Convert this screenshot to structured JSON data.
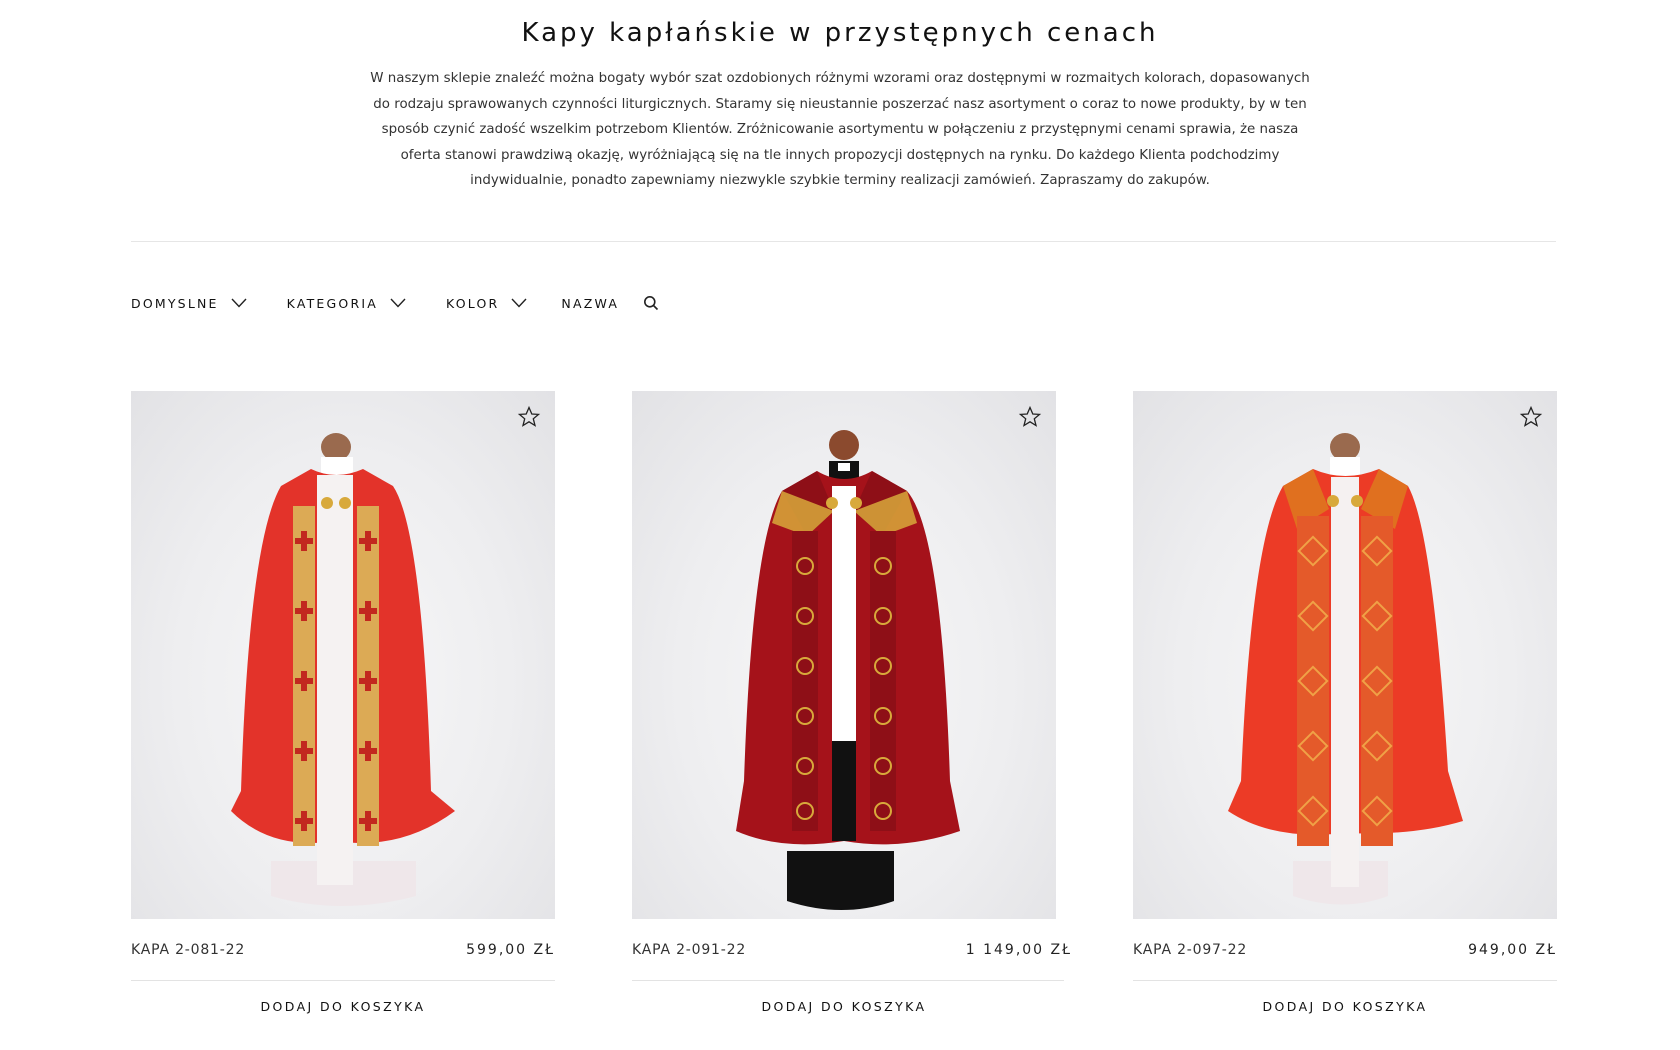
{
  "page": {
    "heading": "Kapy kapłańskie w przystępnych cenach",
    "intro": "W naszym sklepie znaleźć można bogaty wybór szat ozdobionych różnymi wzorami oraz dostępnymi w rozmaitych kolorach, dopasowanych do rodzaju sprawowanych czynności liturgicznych. Staramy się nieustannie poszerzać nasz asortyment o coraz to nowe produkty, by w ten sposób czynić zadość wszelkim potrzebom Klientów. Zróżnicowanie asortymentu w połączeniu z przystępnymi cenami sprawia, że nasza oferta stanowi prawdziwą okazję, wyróżniającą się na tle innych propozycji dostępnych na rynku. Do każdego Klienta podchodzimy indywidualnie, ponadto zapewniamy niezwykle szybkie terminy realizacji zamówień. Zapraszamy do zakupów."
  },
  "filters": {
    "sort_label": "DOMYSLNE",
    "category_label": "KATEGORIA",
    "color_label": "KOLOR",
    "name_label": "NAZWA"
  },
  "products": [
    {
      "name": "KAPA 2-081-22",
      "price": "599,00 ZŁ",
      "add_label": "DODAJ DO KOSZYKA",
      "color": "#e3332a"
    },
    {
      "name": "KAPA 2-091-22",
      "price": "1 149,00 ZŁ",
      "add_label": "DODAJ DO KOSZYKA",
      "color": "#a5121a"
    },
    {
      "name": "KAPA 2-097-22",
      "price": "949,00 ZŁ",
      "add_label": "DODAJ DO KOSZYKA",
      "color": "#ec3b26"
    }
  ],
  "colors": {
    "text": "#111111",
    "divider": "#e6e6e6",
    "gold": "#d8a93b"
  }
}
